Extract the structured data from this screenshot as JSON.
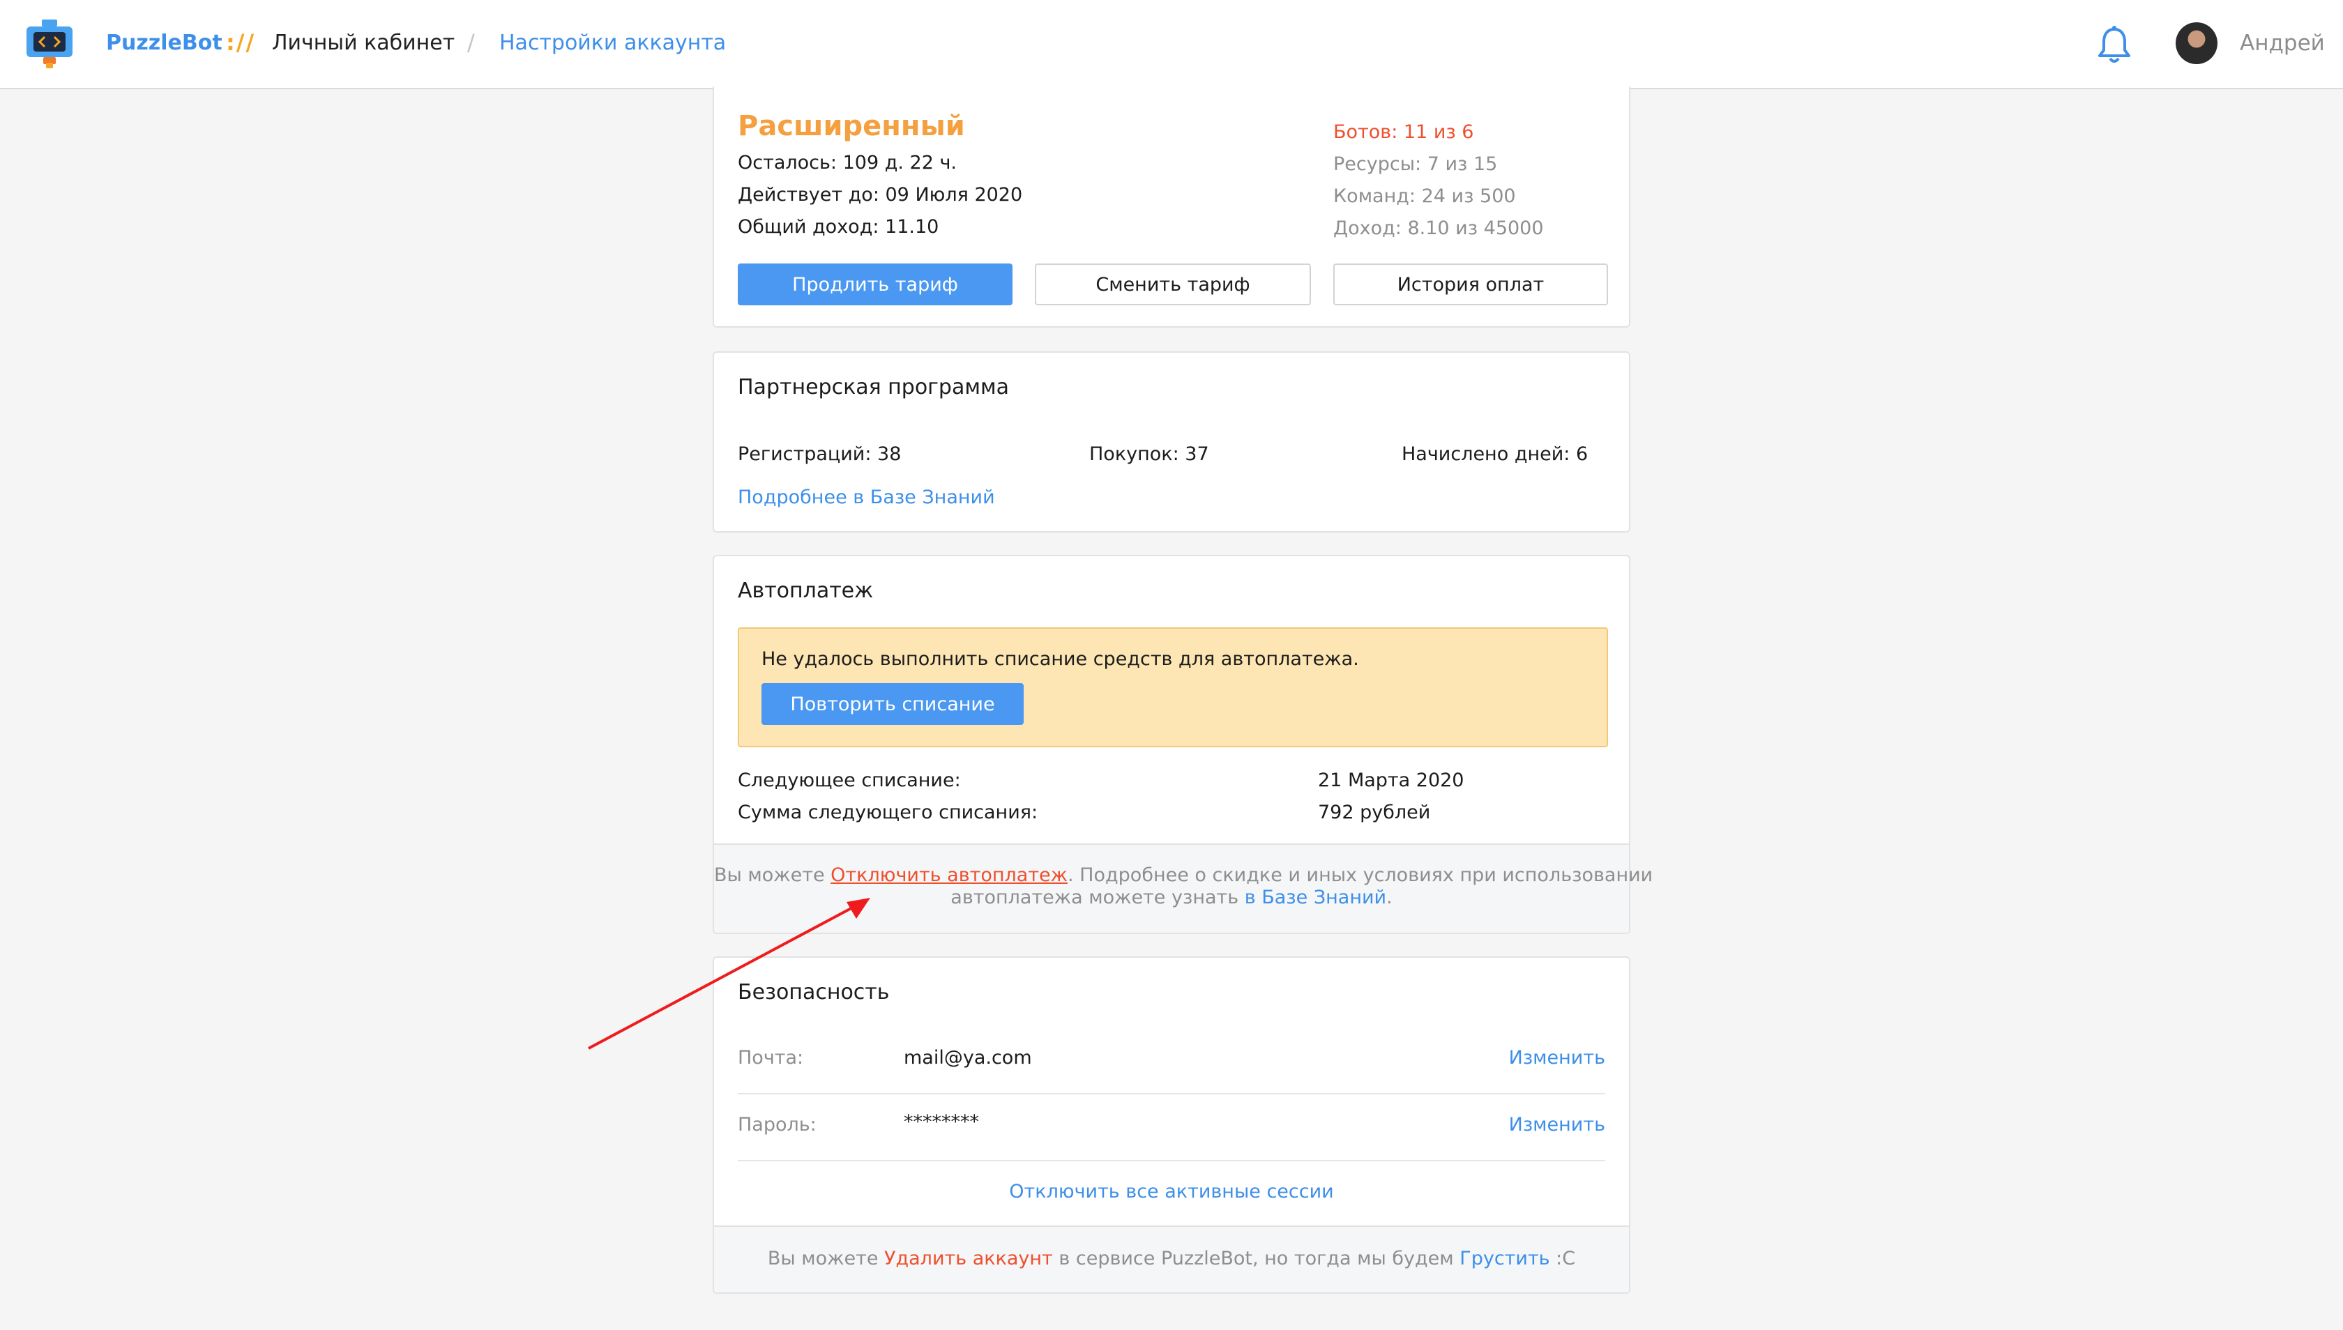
{
  "header": {
    "brand": "PuzzleBot",
    "brand_separator": "://",
    "breadcrumb_cabinet": "Личный кабинет",
    "breadcrumb_slash": "/",
    "breadcrumb_settings": "Настройки аккаунта",
    "user_name": "Андрей"
  },
  "tariff": {
    "plan_name": "Расширенный",
    "remaining": "Осталось: 109 д. 22 ч.",
    "valid_until": "Действует до: 09 Июля 2020",
    "total_income": "Общий доход: 11.10",
    "bots": "Ботов: 11 из 6",
    "resources": "Ресурсы: 7 из 15",
    "commands": "Команд: 24 из 500",
    "income": "Доход: 8.10 из 45000",
    "extend_button": "Продлить тариф",
    "change_button": "Сменить тариф",
    "history_button": "История оплат"
  },
  "partner": {
    "title": "Партнерская программа",
    "registrations": "Регистраций: 38",
    "purchases": "Покупок: 37",
    "days_credited": "Начислено дней: 6",
    "more_link": "Подробнее в Базе Знаний"
  },
  "autopay": {
    "title": "Автоплатеж",
    "warning_text": "Не удалось выполнить списание средств для автоплатежа.",
    "retry_button": "Повторить списание",
    "next_charge_label": "Следующее списание:",
    "next_charge_value": "21 Марта 2020",
    "next_amount_label": "Сумма следующего списания:",
    "next_amount_value": "792 рублей",
    "footer_prefix": "Вы можете ",
    "footer_disable_link": "Отключить автоплатеж",
    "footer_middle": ". Подробнее о скидке и иных условиях при использовании",
    "footer_line2_prefix": "автоплатежа можете узнать ",
    "footer_kb_link": "в Базе Знаний",
    "footer_line2_suffix": "."
  },
  "security": {
    "title": "Безопасность",
    "email_label": "Почта:",
    "email_value": "mail@ya.com",
    "email_change": "Изменить",
    "password_label": "Пароль:",
    "password_value": "********",
    "password_change": "Изменить",
    "end_sessions_link": "Отключить все активные сессии",
    "footer_prefix": "Вы можете ",
    "footer_delete_link": "Удалить аккаунт",
    "footer_middle": " в сервисе PuzzleBot, но тогда мы будем ",
    "footer_sad_link": "Грустить",
    "footer_suffix": " :С"
  },
  "colors": {
    "accent": "#3d8fe9",
    "primary_button": "#4a98f2",
    "plan_orange": "#f5a040",
    "danger": "#ef4f2d",
    "warning_bg": "#fde6b3"
  }
}
